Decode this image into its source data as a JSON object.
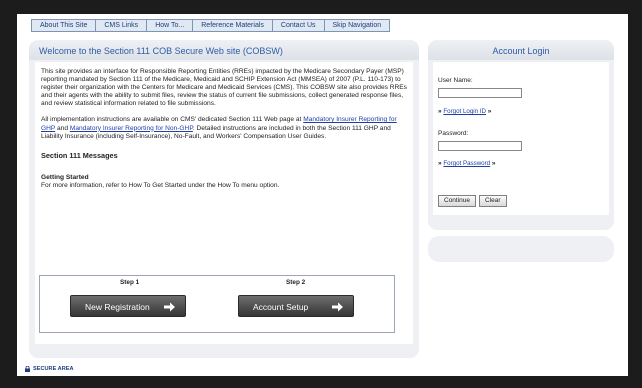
{
  "nav": {
    "items": [
      "About This Site",
      "CMS Links",
      "How To...",
      "Reference Materials",
      "Contact Us",
      "Skip Navigation"
    ]
  },
  "welcome": {
    "title": "Welcome to the Section 111 COB Secure Web site (COBSW)",
    "intro": "This site provides an interface for Responsible Reporting Entities (RREs) impacted by the Medicare Secondary Payer (MSP) reporting mandated by Section 111 of the Medicare, Medicaid and SCHIP Extension Act (MMSEA) of 2007 (P.L. 110-173) to register their organization with the Centers for Medicare and Medicaid Services (CMS). This COBSW site also provides RREs and their agents with the ability to submit files, review the status of current file submissions, collect generated response files, and review statistical information related to file submissions.",
    "impl_before": "All implementation instructions are available on CMS' dedicated Section 111 Web page at ",
    "impl_link1": "Mandatory Insurer Reporting for GHP",
    "impl_and": " and ",
    "impl_link2": "Mandatory Insurer Reporting for Non-GHP",
    "impl_after": ". Detailed instructions are included in both the Section 111 GHP and Liability Insurance (including Self-Insurance), No-Fault, and Workers' Compensation User Guides."
  },
  "messages": {
    "heading": "Section 111 Messages",
    "getting_started": "Getting Started",
    "getting_started_text": "For more information, refer to How To Get Started under the How To menu option."
  },
  "steps": {
    "step1_label": "Step 1",
    "step2_label": "Step 2",
    "step1_button": "New Registration",
    "step2_button": "Account Setup"
  },
  "login": {
    "title": "Account Login",
    "username_label": "User Name:",
    "username_value": "",
    "forgot_login": "Forgot Login ID",
    "password_label": "Password:",
    "password_value": "",
    "forgot_password": "Forgot Password",
    "chevrons": "»",
    "continue_button": "Continue",
    "clear_button": "Clear"
  },
  "footer": {
    "secure_area": "SECURE AREA"
  },
  "colors": {
    "title_blue": "#2e5ca6",
    "link_blue": "#1f3fa6",
    "nav_bg": "#dfe8f3",
    "panel_bg": "#eef0f3",
    "button_dark": "#353535"
  },
  "icons": {
    "step_arrow": "arrow-right-icon",
    "lock": "lock-icon"
  }
}
